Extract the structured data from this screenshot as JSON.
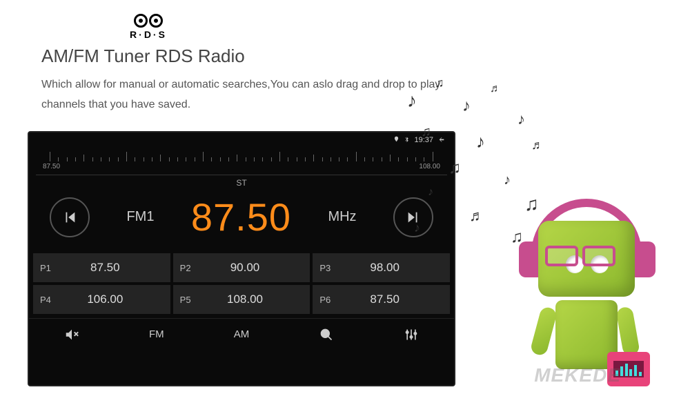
{
  "header": {
    "rds_label": "R·D·S",
    "title": "AM/FM Tuner RDS Radio",
    "description": "Which allow for manual or automatic searches,You can aslo drag and drop to play channels that you have saved."
  },
  "status": {
    "time": "19:37"
  },
  "tuner": {
    "scale_min": "87.50",
    "scale_max": "108.00",
    "st": "ST",
    "band": "FM1",
    "frequency": "87.50",
    "unit": "MHz"
  },
  "presets": [
    {
      "label": "P1",
      "value": "87.50"
    },
    {
      "label": "P2",
      "value": "90.00"
    },
    {
      "label": "P3",
      "value": "98.00"
    },
    {
      "label": "P4",
      "value": "106.00"
    },
    {
      "label": "P5",
      "value": "108.00"
    },
    {
      "label": "P6",
      "value": "87.50"
    }
  ],
  "bottom": {
    "fm": "FM",
    "am": "AM"
  },
  "watermark": "MEKEDE"
}
